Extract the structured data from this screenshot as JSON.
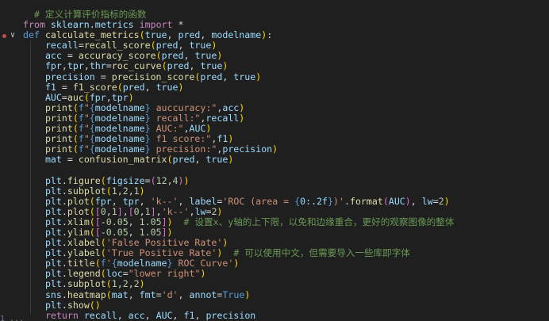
{
  "editor": {
    "language": "python",
    "theme_colors": {
      "background": "#1f1f1f",
      "comment": "#6a9955",
      "keyword": "#c586c0",
      "def_keyword": "#569cd6",
      "function": "#dcdcaa",
      "variable": "#9cdcfe",
      "string": "#ce9178",
      "number": "#b5cea8",
      "breakpoint": "#c94a4a"
    },
    "gutter": {
      "breakpoint_icon": "breakpoint-dot",
      "fold_icon": "chevron-down-icon",
      "fold_glyph": "∨",
      "bottom_partial_text": "1  ..."
    },
    "lines": [
      "  # 定义计算评价指标的函数",
      "from sklearn.metrics import *",
      "def calculate_metrics(true, pred, modelname):",
      "    recall=recall_score(pred, true)",
      "    acc = accuracy_score(pred, true)",
      "    fpr,tpr,thr=roc_curve(pred, true)",
      "    precision = precision_score(pred, true)",
      "    f1 = f1_score(pred, true)",
      "    AUC=auc(fpr,tpr)",
      "    print(f\"{modelname} auccuracy:\",acc)",
      "    print(f\"{modelname} recall:\",recall)",
      "    print(f\"{modelname} AUC:\",AUC)",
      "    print(f\"{modelname} f1 score:\",f1)",
      "    print(f\"{modelname} precision:\",precision)",
      "    mat = confusion_matrix(pred, true)",
      "",
      "    plt.figure(figsize=(12,4))",
      "    plt.subplot(1,2,1)",
      "    plt.plot(fpr, tpr, 'k--', label='ROC (area = {0:.2f})'.format(AUC), lw=2)",
      "    plt.plot([0,1],[0,1],'k--',lw=2)",
      "    plt.xlim([-0.05, 1.05])  # 设置x、y轴的上下限，以免和边缘重合，更好的观察图像的整体",
      "    plt.ylim([-0.05, 1.05])",
      "    plt.xlabel('False Positive Rate')",
      "    plt.ylabel('True Positive Rate')  # 可以使用中文，但需要导入一些库即字体",
      "    plt.title(f'{modelname} ROC Curve')",
      "    plt.legend(loc=\"lower right\")",
      "    plt.subplot(1,2,2)",
      "    sns.heatmap(mat, fmt='d', annot=True)",
      "    plt.show()",
      "    return recall, acc, AUC, f1, precision"
    ]
  }
}
